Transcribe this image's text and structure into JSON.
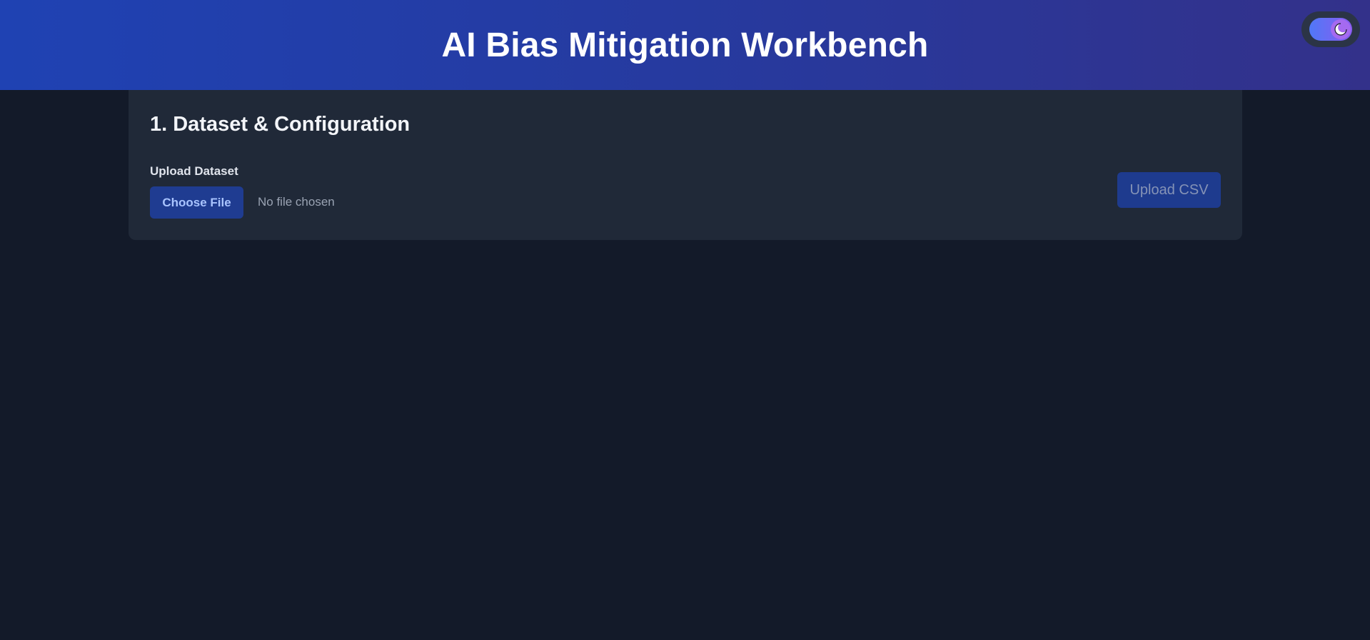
{
  "header": {
    "title": "AI Bias Mitigation Workbench",
    "gradient": [
      "#1f42b3",
      "#33318a"
    ]
  },
  "theme_toggle": {
    "icon": "moon-icon",
    "state": "dark"
  },
  "dataset_section": {
    "title": "1. Dataset & Configuration",
    "upload_label": "Upload Dataset",
    "choose_file_label": "Choose File",
    "file_status": "No file chosen",
    "upload_button_label": "Upload CSV"
  },
  "colors": {
    "background": "#131a29",
    "card": "#202938",
    "accent": "#1f3c91"
  }
}
